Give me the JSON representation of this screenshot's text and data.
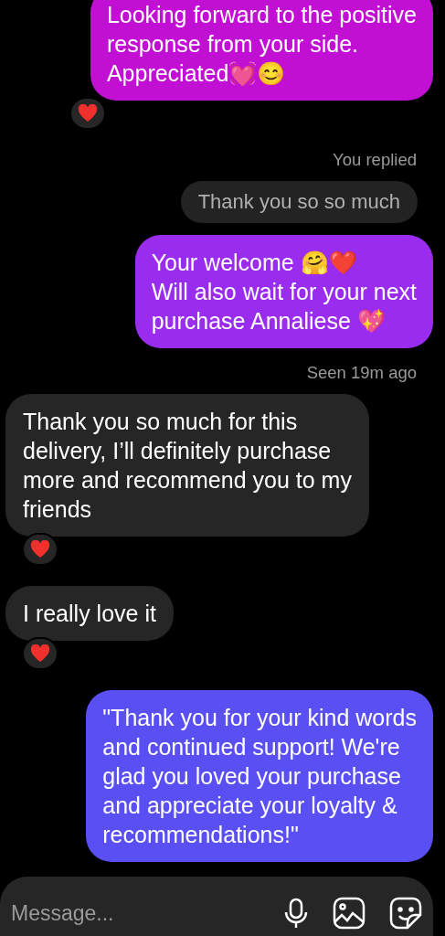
{
  "messages": [
    {
      "kind": "sent",
      "color": "#c10fd3",
      "text": "Looking forward to the positive\nresponse from your side.\nAppreciated💓😊",
      "reaction": true
    },
    {
      "kind": "meta",
      "text": "You replied"
    },
    {
      "kind": "reply",
      "text": "Thank you so so much"
    },
    {
      "kind": "sent",
      "color": "#9a2cf0",
      "text": "Your welcome 🤗❤️\nWill also wait for your next\npurchase Annaliese 💖",
      "reaction": false
    },
    {
      "kind": "meta",
      "text": "Seen 19m ago"
    },
    {
      "kind": "received",
      "text": "Thank you so much for this\ndelivery, I’ll definitely purchase\nmore and recommend you to my\nfriends",
      "reaction": true
    },
    {
      "kind": "received",
      "text": "I really love it",
      "reaction": true
    },
    {
      "kind": "sent",
      "color": "#5a4ff2",
      "text": "\"Thank you for your kind words\nand continued support! We're\nglad you loved your purchase\nand appreciate your loyalty &\nrecommendations!\"",
      "reaction": false
    }
  ],
  "composer": {
    "placeholder": "Message..."
  }
}
